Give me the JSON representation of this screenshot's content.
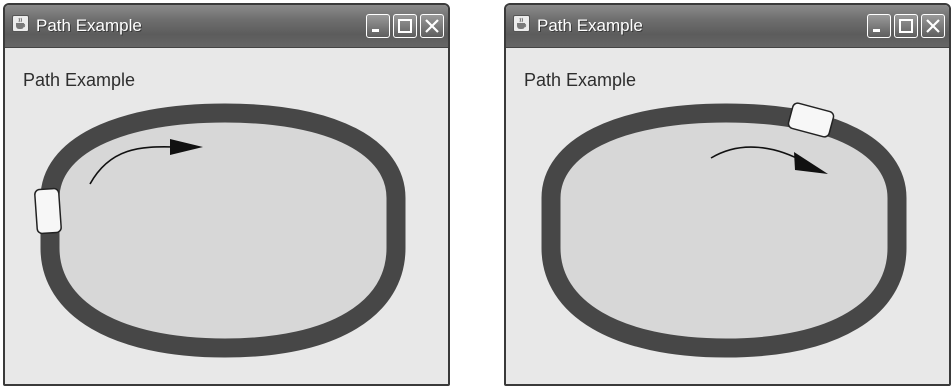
{
  "windows": [
    {
      "title": "Path Example",
      "label": "Path Example",
      "icons": {
        "app": "java-coffee-cup-icon",
        "minimize": "minimize-icon",
        "maximize": "maximize-icon",
        "close": "close-icon"
      }
    },
    {
      "title": "Path Example",
      "label": "Path Example",
      "icons": {
        "app": "java-coffee-cup-icon",
        "minimize": "minimize-icon",
        "maximize": "maximize-icon",
        "close": "close-icon"
      }
    }
  ],
  "colors": {
    "track": "#474747",
    "track_fill": "#d7d7d7",
    "window_bg": "#e8e8e8",
    "titlebar": "#6e6e6e",
    "car_fill": "#f7f7f7",
    "arrow": "#111111"
  }
}
